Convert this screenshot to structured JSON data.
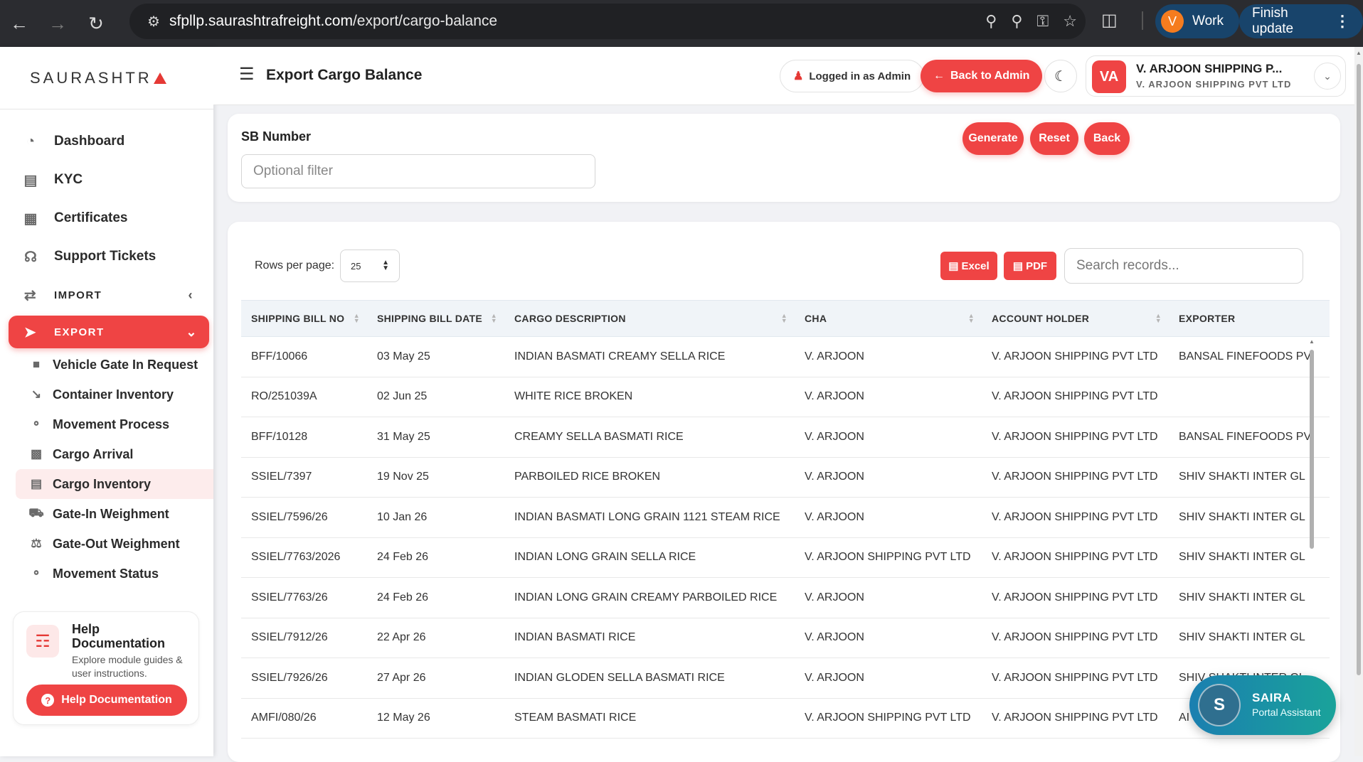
{
  "browser": {
    "url_host": "sfpllp.saurashtrafreight.com",
    "url_path": "/export/cargo-balance",
    "profile_initial": "V",
    "profile_label": "Work",
    "finish_update_label": "Finish update"
  },
  "sidebar": {
    "brand": "SAURASHTR",
    "menu": [
      {
        "label": "Dashboard",
        "icon": "dashboard-icon"
      },
      {
        "label": "KYC",
        "icon": "kyc-icon"
      },
      {
        "label": "Certificates",
        "icon": "certificate-icon"
      },
      {
        "label": "Support Tickets",
        "icon": "headset-icon"
      }
    ],
    "import_label": "IMPORT",
    "export_label": "EXPORT",
    "export_items": [
      {
        "label": "Vehicle Gate In Request",
        "icon": "folder-icon"
      },
      {
        "label": "Container Inventory",
        "icon": "chart-line-icon"
      },
      {
        "label": "Movement Process",
        "icon": "route-icon"
      },
      {
        "label": "Cargo Arrival",
        "icon": "truck-loading-icon"
      },
      {
        "label": "Cargo Inventory",
        "icon": "warehouse-icon"
      },
      {
        "label": "Gate-In Weighment",
        "icon": "truck-icon"
      },
      {
        "label": "Gate-Out Weighment",
        "icon": "scale-icon"
      },
      {
        "label": "Movement Status",
        "icon": "route-icon"
      }
    ],
    "help": {
      "title": "Help Documentation",
      "description": "Explore module guides & user instructions.",
      "button_label": "Help Documentation"
    }
  },
  "header": {
    "title": "Export Cargo Balance",
    "logged_in_label": "Logged in as Admin",
    "back_admin_label": "Back to Admin",
    "user_initials": "VA",
    "user_name": "V. ARJOON SHIPPING P...",
    "user_company": "V. ARJOON SHIPPING PVT LTD"
  },
  "filter": {
    "label": "SB Number",
    "placeholder": "Optional filter",
    "generate_label": "Generate",
    "reset_label": "Reset",
    "back_label": "Back"
  },
  "table": {
    "rows_per_page_label": "Rows per page:",
    "rows_per_page_value": "25",
    "excel_label": "Excel",
    "pdf_label": "PDF",
    "search_placeholder": "Search records...",
    "columns": [
      "SHIPPING BILL NO",
      "SHIPPING BILL DATE",
      "CARGO DESCRIPTION",
      "CHA",
      "ACCOUNT HOLDER",
      "EXPORTER"
    ],
    "rows": [
      [
        "BFF/10066",
        "03 May 25",
        "INDIAN BASMATI CREAMY SELLA RICE",
        "V. ARJOON",
        "V. ARJOON SHIPPING PVT LTD",
        "BANSAL FINEFOODS PV"
      ],
      [
        "RO/251039A",
        "02 Jun 25",
        "WHITE RICE BROKEN",
        "V. ARJOON",
        "V. ARJOON SHIPPING PVT LTD",
        ""
      ],
      [
        "BFF/10128",
        "31 May 25",
        "CREAMY SELLA BASMATI RICE",
        "V. ARJOON",
        "V. ARJOON SHIPPING PVT LTD",
        "BANSAL FINEFOODS PV"
      ],
      [
        "SSIEL/7397",
        "19 Nov 25",
        "PARBOILED RICE BROKEN",
        "V. ARJOON",
        "V. ARJOON SHIPPING PVT LTD",
        "SHIV SHAKTI INTER GL"
      ],
      [
        "SSIEL/7596/26",
        "10 Jan 26",
        "INDIAN BASMATI LONG GRAIN 1121 STEAM RICE",
        "V. ARJOON",
        "V. ARJOON SHIPPING PVT LTD",
        "SHIV SHAKTI INTER GL"
      ],
      [
        "SSIEL/7763/2026",
        "24 Feb 26",
        "INDIAN LONG GRAIN SELLA RICE",
        "V. ARJOON SHIPPING PVT LTD",
        "V. ARJOON SHIPPING PVT LTD",
        "SHIV SHAKTI INTER GL"
      ],
      [
        "SSIEL/7763/26",
        "24 Feb 26",
        "INDIAN LONG GRAIN CREAMY PARBOILED RICE",
        "V. ARJOON",
        "V. ARJOON SHIPPING PVT LTD",
        "SHIV SHAKTI INTER GL"
      ],
      [
        "SSIEL/7912/26",
        "22 Apr 26",
        "INDIAN BASMATI RICE",
        "V. ARJOON",
        "V. ARJOON SHIPPING PVT LTD",
        "SHIV SHAKTI INTER GL"
      ],
      [
        "SSIEL/7926/26",
        "27 Apr 26",
        "INDIAN GLODEN SELLA BASMATI RICE",
        "V. ARJOON",
        "V. ARJOON SHIPPING PVT LTD",
        "SHIV SHAKTI INTER GL"
      ],
      [
        "AMFI/080/26",
        "12 May 26",
        "STEAM BASMATI RICE",
        "V. ARJOON SHIPPING PVT LTD",
        "V. ARJOON SHIPPING PVT LTD",
        "AI"
      ]
    ]
  },
  "assistant": {
    "initial": "S",
    "name": "SAIRA",
    "subtitle": "Portal Assistant"
  }
}
